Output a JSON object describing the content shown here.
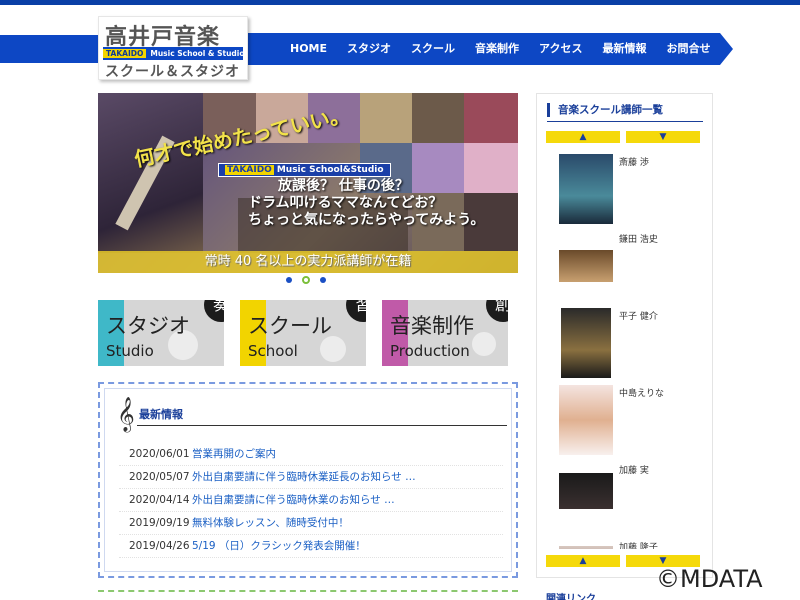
{
  "brand": {
    "title": "高井戸音楽",
    "band_left": "TAKAIDO",
    "band_right": "Music School & Studio",
    "subtitle": "スクール＆スタジオ"
  },
  "nav": {
    "items": [
      "HOME",
      "スタジオ",
      "スクール",
      "音楽制作",
      "アクセス",
      "最新情報",
      "お問合せ"
    ]
  },
  "hero": {
    "line1": "何才で始めたっていい。",
    "badge_left": "TAKAIDO",
    "badge_right": "Music School&Studio",
    "line2": "放課後？ 仕事の後？",
    "line3": "ドラム叩けるママなんてどお？",
    "line4": "ちょっと気になったらやってみよう。",
    "banner": "常時 40 名以上の実力派講師が在籍",
    "slides_total": 3,
    "slide_active": 2
  },
  "tiles": [
    {
      "jp": "スタジオ",
      "en": "Studio",
      "badge": "奏",
      "color": "#3fb8c8"
    },
    {
      "jp": "スクール",
      "en": "School",
      "badge": "習",
      "color": "#f2d400"
    },
    {
      "jp": "音楽制作",
      "en": "Production",
      "badge": "創",
      "color": "#c05aa8"
    }
  ],
  "news": {
    "title": "最新情報",
    "items": [
      {
        "date": "2020/06/01",
        "title": "営業再開のご案内"
      },
      {
        "date": "2020/05/07",
        "title": "外出自粛要請に伴う臨時休業延長のお知らせ …"
      },
      {
        "date": "2020/04/14",
        "title": "外出自粛要請に伴う臨時休業のお知らせ …"
      },
      {
        "date": "2019/09/19",
        "title": "無料体験レッスン、随時受付中！"
      },
      {
        "date": "2019/04/26",
        "title": "5/19 （日）クラシック発表会開催！"
      }
    ]
  },
  "sidebar": {
    "title": "音楽スクール講師一覧",
    "up": "▲",
    "down": "▼",
    "teachers": [
      {
        "name": "斎藤 渉"
      },
      {
        "name": "鎌田 浩史"
      },
      {
        "name": "平子 健介"
      },
      {
        "name": "中島えりな"
      },
      {
        "name": "加藤 実"
      },
      {
        "name": "加藤 隆子"
      }
    ],
    "next_section": "関連リンク"
  },
  "copyright": "©MDATA"
}
